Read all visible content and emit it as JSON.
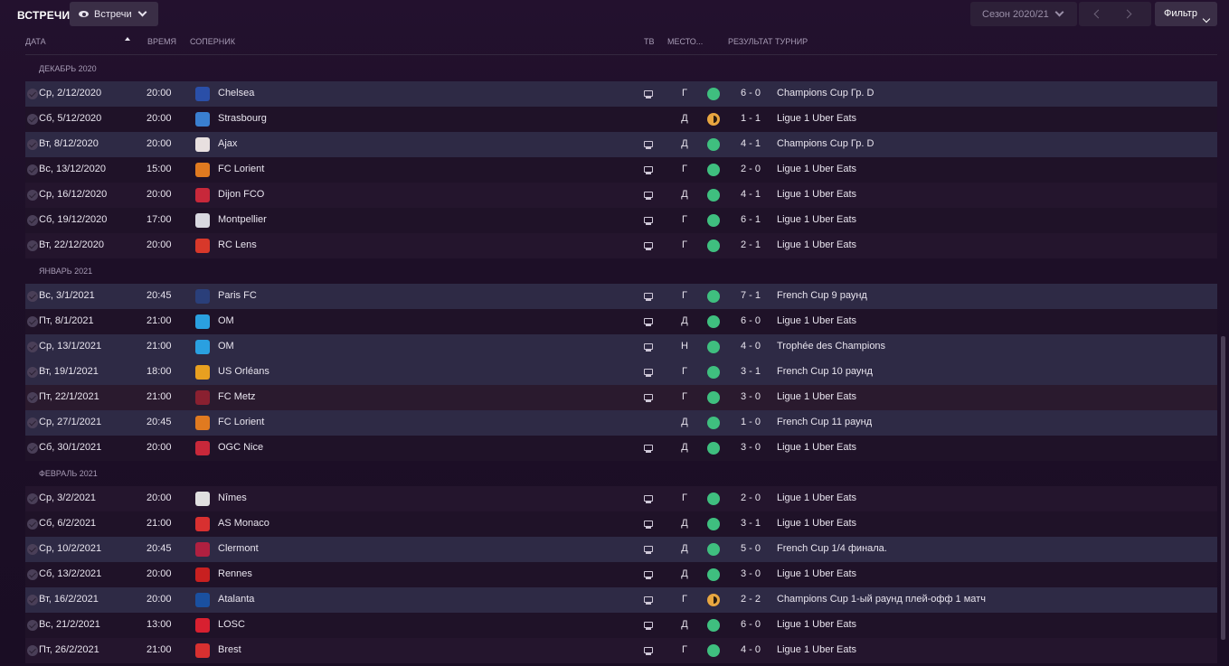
{
  "header": {
    "title": "ВСТРЕЧИ",
    "view_dropdown": "Встречи",
    "season_dropdown": "Сезон 2020/21",
    "filter_button": "Фильтр"
  },
  "columns": {
    "date": "ДАТА",
    "time": "ВРЕМЯ",
    "opponent": "СОПЕРНИК",
    "tv": "ТВ",
    "venue": "МЕСТО...",
    "result": "РЕЗУЛЬТАТ",
    "competition": "ТУРНИР"
  },
  "months": [
    "ДЕКАБРЬ 2020",
    "ЯНВАРЬ 2021",
    "ФЕВРАЛЬ 2021"
  ],
  "colors": {
    "win": "#3fbf7f",
    "draw": "#e8a640"
  },
  "fixtures": [
    {
      "date": "Ср, 2/12/2020",
      "time": "20:00",
      "opponent": "Chelsea",
      "crest_color": "#2a4fa8",
      "tv": true,
      "venue": "Г",
      "outcome": "win",
      "score": "6 - 0",
      "competition": "Champions Cup Гр. D",
      "style": "hl"
    },
    {
      "date": "Сб, 5/12/2020",
      "time": "20:00",
      "opponent": "Strasbourg",
      "crest_color": "#3a7fd0",
      "tv": false,
      "venue": "Д",
      "outcome": "draw",
      "score": "1 - 1",
      "competition": "Ligue 1 Uber Eats",
      "style": "dark"
    },
    {
      "date": "Вт, 8/12/2020",
      "time": "20:00",
      "opponent": "Ajax",
      "crest_color": "#e8e0e0",
      "tv": true,
      "venue": "Д",
      "outcome": "win",
      "score": "4 - 1",
      "competition": "Champions Cup Гр. D",
      "style": "hl"
    },
    {
      "date": "Вс, 13/12/2020",
      "time": "15:00",
      "opponent": "FC Lorient",
      "crest_color": "#e07a20",
      "tv": true,
      "venue": "Г",
      "outcome": "win",
      "score": "2 - 0",
      "competition": "Ligue 1 Uber Eats",
      "style": "dark"
    },
    {
      "date": "Ср, 16/12/2020",
      "time": "20:00",
      "opponent": "Dijon FCO",
      "crest_color": "#c8283a",
      "tv": true,
      "venue": "Д",
      "outcome": "win",
      "score": "4 - 1",
      "competition": "Ligue 1 Uber Eats",
      "style": "mid"
    },
    {
      "date": "Сб, 19/12/2020",
      "time": "17:00",
      "opponent": "Montpellier",
      "crest_color": "#d8d8e0",
      "tv": true,
      "venue": "Г",
      "outcome": "win",
      "score": "6 - 1",
      "competition": "Ligue 1 Uber Eats",
      "style": "dark"
    },
    {
      "date": "Вт, 22/12/2020",
      "time": "20:00",
      "opponent": "RC Lens",
      "crest_color": "#d8382a",
      "tv": true,
      "venue": "Г",
      "outcome": "win",
      "score": "2 - 1",
      "competition": "Ligue 1 Uber Eats",
      "style": "mid"
    },
    {
      "date": "Вс, 3/1/2021",
      "time": "20:45",
      "opponent": "Paris FC",
      "crest_color": "#2a3f7a",
      "tv": true,
      "venue": "Г",
      "outcome": "win",
      "score": "7 - 1",
      "competition": "French Cup 9 раунд",
      "style": "hl"
    },
    {
      "date": "Пт, 8/1/2021",
      "time": "21:00",
      "opponent": "OM",
      "crest_color": "#2aa0e0",
      "tv": true,
      "venue": "Д",
      "outcome": "win",
      "score": "6 - 0",
      "competition": "Ligue 1 Uber Eats",
      "style": "dark"
    },
    {
      "date": "Ср, 13/1/2021",
      "time": "21:00",
      "opponent": "OM",
      "crest_color": "#2aa0e0",
      "tv": true,
      "venue": "Н",
      "outcome": "win",
      "score": "4 - 0",
      "competition": "Trophée des Champions",
      "style": "hl"
    },
    {
      "date": "Вт, 19/1/2021",
      "time": "18:00",
      "opponent": "US Orléans",
      "crest_color": "#e8a020",
      "tv": true,
      "venue": "Г",
      "outcome": "win",
      "score": "3 - 1",
      "competition": "French Cup 10 раунд",
      "style": "hl"
    },
    {
      "date": "Пт, 22/1/2021",
      "time": "21:00",
      "opponent": "FC Metz",
      "crest_color": "#8a2030",
      "tv": true,
      "venue": "Г",
      "outcome": "win",
      "score": "3 - 0",
      "competition": "Ligue 1 Uber Eats",
      "style": "sel"
    },
    {
      "date": "Ср, 27/1/2021",
      "time": "20:45",
      "opponent": "FC Lorient",
      "crest_color": "#e07a20",
      "tv": false,
      "venue": "Д",
      "outcome": "win",
      "score": "1 - 0",
      "competition": "French Cup 11 раунд",
      "style": "hl"
    },
    {
      "date": "Сб, 30/1/2021",
      "time": "20:00",
      "opponent": "OGC Nice",
      "crest_color": "#c8283a",
      "tv": true,
      "venue": "Д",
      "outcome": "win",
      "score": "3 - 0",
      "competition": "Ligue 1 Uber Eats",
      "style": "dark"
    },
    {
      "date": "Ср, 3/2/2021",
      "time": "20:00",
      "opponent": "Nîmes",
      "crest_color": "#e0e0e0",
      "tv": true,
      "venue": "Г",
      "outcome": "win",
      "score": "2 - 0",
      "competition": "Ligue 1 Uber Eats",
      "style": "mid"
    },
    {
      "date": "Сб, 6/2/2021",
      "time": "21:00",
      "opponent": "AS Monaco",
      "crest_color": "#d83030",
      "tv": true,
      "venue": "Д",
      "outcome": "win",
      "score": "3 - 1",
      "competition": "Ligue 1 Uber Eats",
      "style": "dark"
    },
    {
      "date": "Ср, 10/2/2021",
      "time": "20:45",
      "opponent": "Clermont",
      "crest_color": "#b02040",
      "tv": true,
      "venue": "Д",
      "outcome": "win",
      "score": "5 - 0",
      "competition": "French Cup 1/4 финала.",
      "style": "hl"
    },
    {
      "date": "Сб, 13/2/2021",
      "time": "20:00",
      "opponent": "Rennes",
      "crest_color": "#c82020",
      "tv": true,
      "venue": "Д",
      "outcome": "win",
      "score": "3 - 0",
      "competition": "Ligue 1 Uber Eats",
      "style": "dark"
    },
    {
      "date": "Вт, 16/2/2021",
      "time": "20:00",
      "opponent": "Atalanta",
      "crest_color": "#1a50a0",
      "tv": true,
      "venue": "Г",
      "outcome": "draw",
      "score": "2 - 2",
      "competition": "Champions Cup 1-ый раунд плей-офф 1 матч",
      "style": "hl"
    },
    {
      "date": "Вс, 21/2/2021",
      "time": "13:00",
      "opponent": "LOSC",
      "crest_color": "#d82030",
      "tv": true,
      "venue": "Д",
      "outcome": "win",
      "score": "6 - 0",
      "competition": "Ligue 1 Uber Eats",
      "style": "dark"
    },
    {
      "date": "Пт, 26/2/2021",
      "time": "21:00",
      "opponent": "Brest",
      "crest_color": "#d83030",
      "tv": true,
      "venue": "Г",
      "outcome": "win",
      "score": "4 - 0",
      "competition": "Ligue 1 Uber Eats",
      "style": "mid"
    }
  ]
}
